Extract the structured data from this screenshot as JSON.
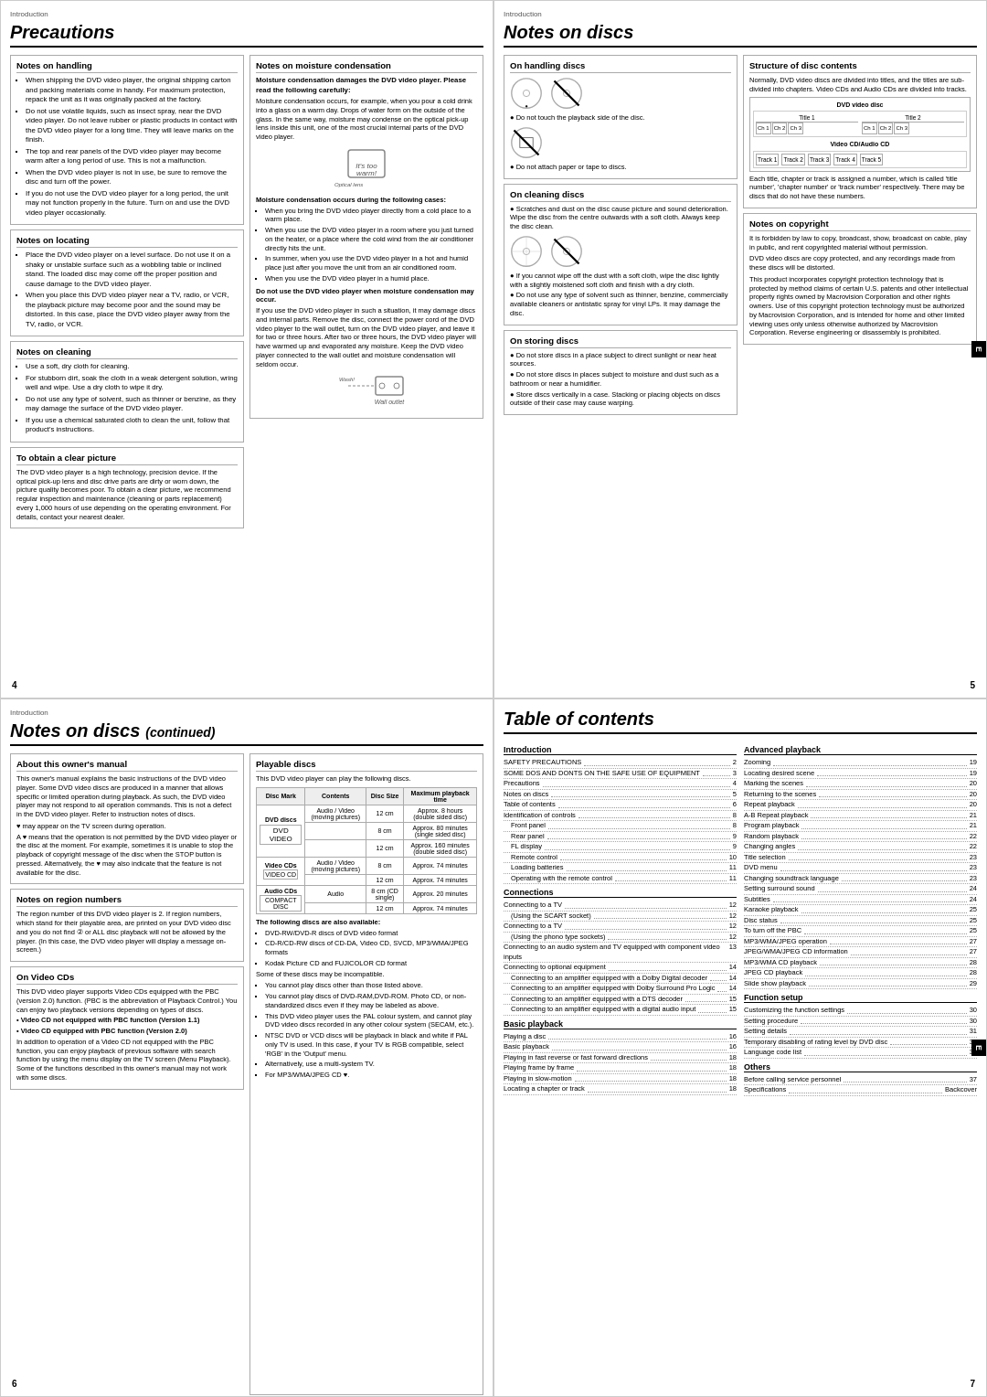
{
  "pages": {
    "precautions": {
      "label": "Introduction",
      "title": "Precautions",
      "page_num": "4",
      "cols": {
        "left": {
          "handling": {
            "title": "Notes on handling",
            "items": [
              "When shipping the DVD video player, the original shipping carton and packing materials come in handy. For maximum protection, repack the unit as it was originally packed at the factory.",
              "Do not use volatile liquids, such as insect spray, near the DVD video player. Do not leave rubber or plastic products in contact with the DVD video player for a long time. They will leave marks on the finish.",
              "The top and rear panels of the DVD video player may become warm after a long period of use. This is not a malfunction.",
              "When the DVD video player is not in use, be sure to remove the disc and turn off the power.",
              "If you do not use the DVD video player for a long period, the unit may not function properly in the future. Turn on and use the DVD video player occasionally."
            ]
          },
          "locating": {
            "title": "Notes on locating",
            "items": [
              "Place the DVD video player on a level surface. Do not use it on a shaky or unstable surface such as a wobbling table or inclined stand. The loaded disc may come off the proper position and cause damage to the DVD video player.",
              "When you place this DVD video player near a TV, radio, or VCR, the playback picture may become poor and the sound may be distorted. In this case, place the DVD video player away from the TV, radio, or VCR."
            ]
          },
          "cleaning": {
            "title": "Notes on cleaning",
            "items": [
              "Use a soft, dry cloth for cleaning.",
              "For stubborn dirt, soak the cloth in a weak detergent solution, wring well and wipe. Use a dry cloth to wipe it dry.",
              "Do not use any type of solvent, such as thinner or benzine, as they may damage the surface of the DVD video player.",
              "If you use a chemical saturated cloth to clean the unit, follow that product's instructions."
            ]
          },
          "clear_picture": {
            "title": "To obtain a clear picture",
            "body": "The DVD video player is a high technology, precision device. If the optical pick-up lens and disc drive parts are dirty or worn down, the picture quality becomes poor. To obtain a clear picture, we recommend regular inspection and maintenance (cleaning or parts replacement) every 1,000 hours of use depending on the operating environment. For details, contact your nearest dealer."
          }
        },
        "right": {
          "moisture": {
            "title": "Notes on moisture condensation",
            "warning": "Moisture condensation damages the DVD video player. Please read the following carefully:",
            "body": "Moisture condensation occurs, for example, when you pour a cold drink into a glass on a warm day. Drops of water form on the outside of the glass. In the same way, moisture may condense on the optical pick-up lens inside this unit, one of the most crucial internal parts of the DVD video player.",
            "cases_title": "Moisture condensation occurs during the following cases:",
            "cases": [
              "When you bring the DVD video player directly from a cold place to a warm place.",
              "When you use the DVD video player in a room where you just turned on the heater, or a place where the cold wind from the air conditioner directly hits the unit.",
              "In summer, when you use the DVD video player in a hot and humid place just after you move the unit from an air conditioned room.",
              "When you use the DVD video player in a humid place."
            ],
            "advice": "Do not use the DVD video player when moisture condensation may occur.",
            "advice_body": "If you use the DVD video player in such a situation, it may damage discs and internal parts. Remove the disc, connect the power cord of the DVD video player to the wall outlet, turn on the DVD video player, and leave it for two or three hours. After two or three hours, the DVD video player will have warmed up and evaporated any moisture. Keep the DVD video player connected to the wall outlet and moisture condensation will seldom occur."
          }
        }
      }
    },
    "notes_discs": {
      "label": "Introduction",
      "title": "Notes on discs",
      "page_num": "5",
      "cols": {
        "left": {
          "handling": {
            "title": "On handling discs",
            "items": [
              "Do not touch the playback side of the disc.",
              "Do not attach paper or tape to discs."
            ]
          },
          "cleaning": {
            "title": "On cleaning discs",
            "body": "Scratches and dust on the disc cause picture and sound deterioration. Wipe the disc from the centre outwards with a soft cloth. Always keep the disc clean.",
            "extra": [
              "If you cannot wipe off the dust with a soft cloth, wipe the disc lightly with a slightly moistened soft cloth and finish with a dry cloth.",
              "Do not use any type of solvent such as thinner, benzine, commercially available cleaners or antistatic spray for vinyl LPs. It may damage the disc."
            ]
          },
          "storing": {
            "title": "On storing discs",
            "items": [
              "Do not store discs in a place subject to direct sunlight or near heat sources.",
              "Do not store discs in places subject to moisture and dust such as a bathroom or near a humidifier.",
              "Store discs vertically in a case. Stacking or placing objects on discs outside of their case may cause warping."
            ]
          }
        },
        "right": {
          "structure": {
            "title": "Structure of disc contents",
            "body": "Normally, DVD video discs are divided into titles, and the titles are sub-divided into chapters. Video CDs and Audio CDs are divided into tracks.",
            "note": "Each title, chapter or track is assigned a number, which is called 'title number', 'chapter number' or 'track number' respectively. There may be discs that do not have these numbers."
          },
          "copyright": {
            "title": "Notes on copyright",
            "body1": "It is forbidden by law to copy, broadcast, show, broadcast on cable, play in public, and rent copyrighted material without permission.",
            "body2": "DVD video discs are copy protected, and any recordings made from these discs will be distorted.",
            "body3": "This product incorporates copyright protection technology that is protected by method claims of certain U.S. patents and other intellectual property rights owned by Macrovision Corporation and other rights owners. Use of this copyright protection technology must be authorized by Macrovision Corporation, and is intended for home and other limited viewing uses only unless otherwise authorized by Macrovision Corporation. Reverse engineering or disassembly is prohibited."
          }
        }
      }
    },
    "notes_discs_cont": {
      "label": "Introduction",
      "title": "Notes on discs",
      "subtitle": "(continued)",
      "page_num": "6",
      "cols": {
        "left": {
          "owners_manual": {
            "title": "About this owner's manual",
            "body": "This owner's manual explains the basic instructions of the DVD video player. Some DVD video discs are produced in a manner that allows specific or limited operation during playback. As such, the DVD video player may not respond to all operation commands. This is not a defect in the DVD video player. Refer to instruction notes of discs.",
            "notes": [
              "♥ may appear on the TV screen during operation.",
              "A ♥ means that the operation is not permitted by the DVD video player or the disc at the moment. For example, sometimes it is unable to stop the playback of copyright message of the disc when the STOP button is pressed. Alternatively, the ♥ may also indicate that the feature is not available for the disc."
            ]
          },
          "region_numbers": {
            "title": "Notes on region numbers",
            "body": "The region number of this DVD video player is 2. If region numbers, which stand for their playable area, are printed on your DVD video disc and you do not find ② or ALL disc playback will not be allowed by the player. (In this case, the DVD video player will display a message on-screen.)"
          },
          "video_cds": {
            "title": "On Video CDs",
            "body": "This DVD video player supports Video CDs equipped with the PBC (version 2.0) function. (PBC is the abbreviation of Playback Control.) You can enjoy two playback versions depending on types of discs.",
            "versions": [
              "Video CD not equipped with PBC function (Version 1.1)",
              "Video CD equipped with PBC function (Version 2.0)"
            ],
            "extra": "In addition to operation of a Video CD not equipped with the PBC function, you can enjoy playback of previous software with search function by using the menu display on the TV screen (Menu Playback). Some of the functions described in this owner's manual may not work with some discs."
          }
        },
        "right": {
          "playable": {
            "title": "Playable discs",
            "intro": "This DVD video player can play the following discs.",
            "table_headers": [
              "Disc Mark",
              "Contents",
              "Disc Size",
              "Maximum playback time"
            ],
            "table_rows": [
              [
                "DVD discs",
                "Audio / Video (moving pictures)",
                "12 cm",
                "Approx. 8 hours (double sided disc)"
              ],
              [
                "",
                "",
                "8 cm",
                "Approx. 80 minutes (single sided disc)"
              ],
              [
                "",
                "",
                "12 cm",
                "Approx. 160 minutes (double sided disc)"
              ],
              [
                "Video CDs",
                "Audio / Video (moving pictures)",
                "8 cm",
                "Approx. 74 minutes"
              ],
              [
                "",
                "",
                "12 cm",
                "Approx. 74 minutes"
              ],
              [
                "Audio CDs",
                "Audio",
                "8 cm (CD single)",
                "Approx. 20 minutes"
              ],
              [
                "",
                "",
                "12 cm",
                "Approx. 74 minutes"
              ]
            ],
            "also_play": "The following discs are also available:",
            "also_items": [
              "DVD-RW/DVD-R discs of DVD video format",
              "CD-R/CD-RW discs of CD-DA, Video CD, SVCD, MP3/WMA/JPEG formats",
              "Kodak Picture CD and FUJICOLOR CD format"
            ],
            "cannot_play": "Some of these discs may be incompatible.",
            "notes": [
              "You cannot play discs other than those listed above.",
              "You cannot play discs of DVD-RAM,DVD-ROM. Photo CD, or non-standardized discs even if they may be labeled as above.",
              "This DVD video player uses the PAL colour system, and cannot play DVD video discs recorded in any other colour system (SECAM, etc.).",
              "NTSC DVD or VCD discs will be playback in black and white if PAL only TV is used. In this case, if your TV is RGB compatible, select 'RGB' in the 'Output' menu.",
              "Alternatively, use a multi-system TV.",
              "For MP3/WMA/JPEG CD ♥."
            ]
          }
        }
      }
    },
    "toc": {
      "title": "Table of contents",
      "page_num": "7",
      "introduction": {
        "title": "Introduction",
        "items": [
          {
            "label": "SAFETY PRECAUTIONS",
            "page": "2"
          },
          {
            "label": "SOME DOS AND DONTS ON THE SAFE USE OF EQUIPMENT",
            "page": "3"
          },
          {
            "label": "Precautions",
            "page": "4"
          },
          {
            "label": "Notes on discs",
            "page": "5"
          },
          {
            "label": "Table of contents",
            "page": "6"
          },
          {
            "label": "Identification of controls",
            "page": "8"
          },
          {
            "label": "Front panel",
            "page": "8"
          },
          {
            "label": "Rear panel",
            "page": "9"
          },
          {
            "label": "FL display",
            "page": "9"
          },
          {
            "label": "Remote control",
            "page": "10"
          },
          {
            "label": "Loading batteries",
            "page": "11"
          },
          {
            "label": "Operating with the remote control",
            "page": "11"
          }
        ]
      },
      "connections": {
        "title": "Connections",
        "items": [
          {
            "label": "Connecting to a TV",
            "page": "12"
          },
          {
            "label": "(Using the SCART socket)",
            "page": "12"
          },
          {
            "label": "Connecting to a TV",
            "page": "12"
          },
          {
            "label": "(Using the phono type sockets)",
            "page": "12"
          },
          {
            "label": "Connecting to an audio system and TV equipped with component video inputs",
            "page": "13"
          },
          {
            "label": "Connecting to optional equipment",
            "page": "14"
          },
          {
            "label": "Connecting to an amplifier equipped with a Dolby Digital decoder",
            "page": "14"
          },
          {
            "label": "Connecting to an amplifier equipped with Dolby Surround Pro Logic",
            "page": "14"
          },
          {
            "label": "Connecting to an amplifier equipped with a DTS decoder",
            "page": "15"
          },
          {
            "label": "Connecting to an amplifier equipped with a digital audio input",
            "page": "15"
          }
        ]
      },
      "basic_playback": {
        "title": "Basic playback",
        "items": [
          {
            "label": "Playing a disc",
            "page": "16"
          },
          {
            "label": "Basic playback",
            "page": "16"
          },
          {
            "label": "Playing in fast reverse or fast forward directions",
            "page": "18"
          },
          {
            "label": "Playing frame by frame",
            "page": "18"
          },
          {
            "label": "Playing in slow-motion",
            "page": "18"
          },
          {
            "label": "Locating a chapter or track",
            "page": "18"
          }
        ]
      },
      "advanced": {
        "title": "Advanced playback",
        "items": [
          {
            "label": "Zooming",
            "page": "19"
          },
          {
            "label": "Locating desired scene",
            "page": "19"
          },
          {
            "label": "Marking the scenes",
            "page": "20"
          },
          {
            "label": "Returning to the scenes",
            "page": "20"
          },
          {
            "label": "Repeat playback",
            "page": "20"
          },
          {
            "label": "A-B Repeat playback",
            "page": "21"
          },
          {
            "label": "Program playback",
            "page": "21"
          },
          {
            "label": "Random playback",
            "page": "22"
          },
          {
            "label": "Changing angles",
            "page": "22"
          },
          {
            "label": "Title selection",
            "page": "23"
          },
          {
            "label": "DVD menu",
            "page": "23"
          },
          {
            "label": "Changing soundtrack language",
            "page": "23"
          },
          {
            "label": "Setting surround sound",
            "page": "24"
          },
          {
            "label": "Subtitles",
            "page": "24"
          },
          {
            "label": "Karaoke playback",
            "page": "25"
          },
          {
            "label": "Disc status",
            "page": "25"
          },
          {
            "label": "To turn off the PBC",
            "page": "25"
          },
          {
            "label": "MP3/WMA/JPEG operation",
            "page": "27"
          },
          {
            "label": "JPEG/WMA/JPEG CD information",
            "page": "27"
          },
          {
            "label": "MP3/WMA CD playback",
            "page": "28"
          },
          {
            "label": "JPEG CD playback",
            "page": "28"
          },
          {
            "label": "Slide show playback",
            "page": "29"
          }
        ]
      },
      "function_setup": {
        "title": "Function setup",
        "items": [
          {
            "label": "Customizing the function settings",
            "page": "30"
          },
          {
            "label": "Setting procedure",
            "page": "30"
          },
          {
            "label": "Setting details",
            "page": "31"
          },
          {
            "label": "Temporary disabling of rating level by DVD disc",
            "page": "35"
          },
          {
            "label": "Language code list",
            "page": "36"
          }
        ]
      },
      "others": {
        "title": "Others",
        "items": [
          {
            "label": "Before calling service personnel",
            "page": "37"
          },
          {
            "label": "Specifications",
            "page": "Backcover"
          }
        ]
      }
    }
  }
}
